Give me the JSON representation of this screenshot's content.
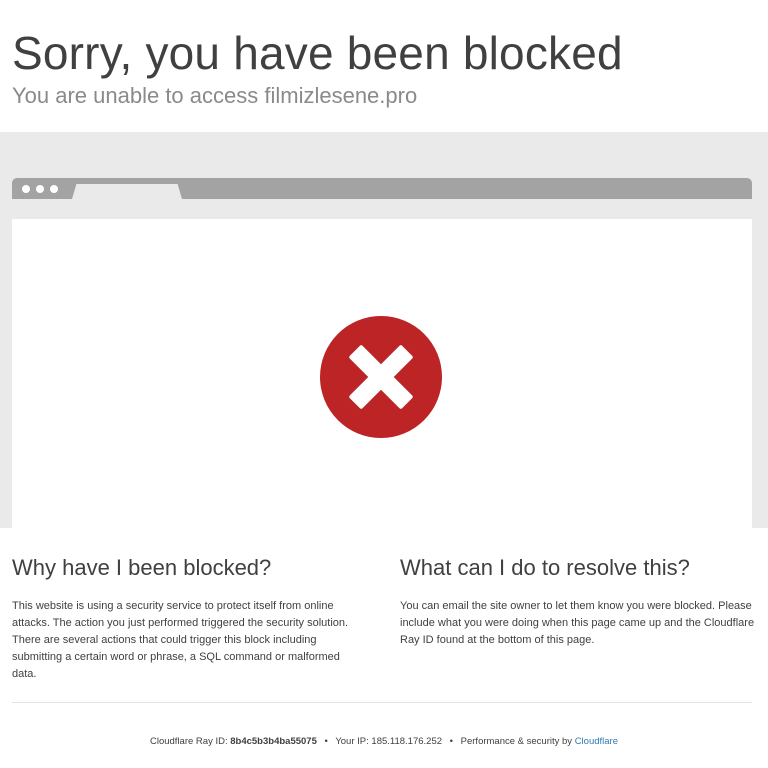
{
  "header": {
    "title": "Sorry, you have been blocked",
    "subtitle": "You are unable to access filmizlesene.pro"
  },
  "illustration": {
    "error_icon": "error-x-icon",
    "error_color": "#bd2426",
    "bar_color": "#a3a3a3",
    "band_color": "#eaeaea"
  },
  "why": {
    "heading": "Why have I been blocked?",
    "body": "This website is using a security service to protect itself from online attacks. The action you just performed triggered the security solution. There are several actions that could trigger this block including submitting a certain word or phrase, a SQL command or malformed data."
  },
  "resolve": {
    "heading": "What can I do to resolve this?",
    "body": "You can email the site owner to let them know you were blocked. Please include what you were doing when this page came up and the Cloudflare Ray ID found at the bottom of this page."
  },
  "footer": {
    "ray_label": "Cloudflare Ray ID:",
    "ray_id": "8b4c5b3b4ba55075",
    "ip_label": "Your IP:",
    "ip": "185.118.176.252",
    "perf_label": "Performance & security by",
    "cloudflare_link": "Cloudflare",
    "separator": "•",
    "link_color": "#2c7cb0"
  }
}
